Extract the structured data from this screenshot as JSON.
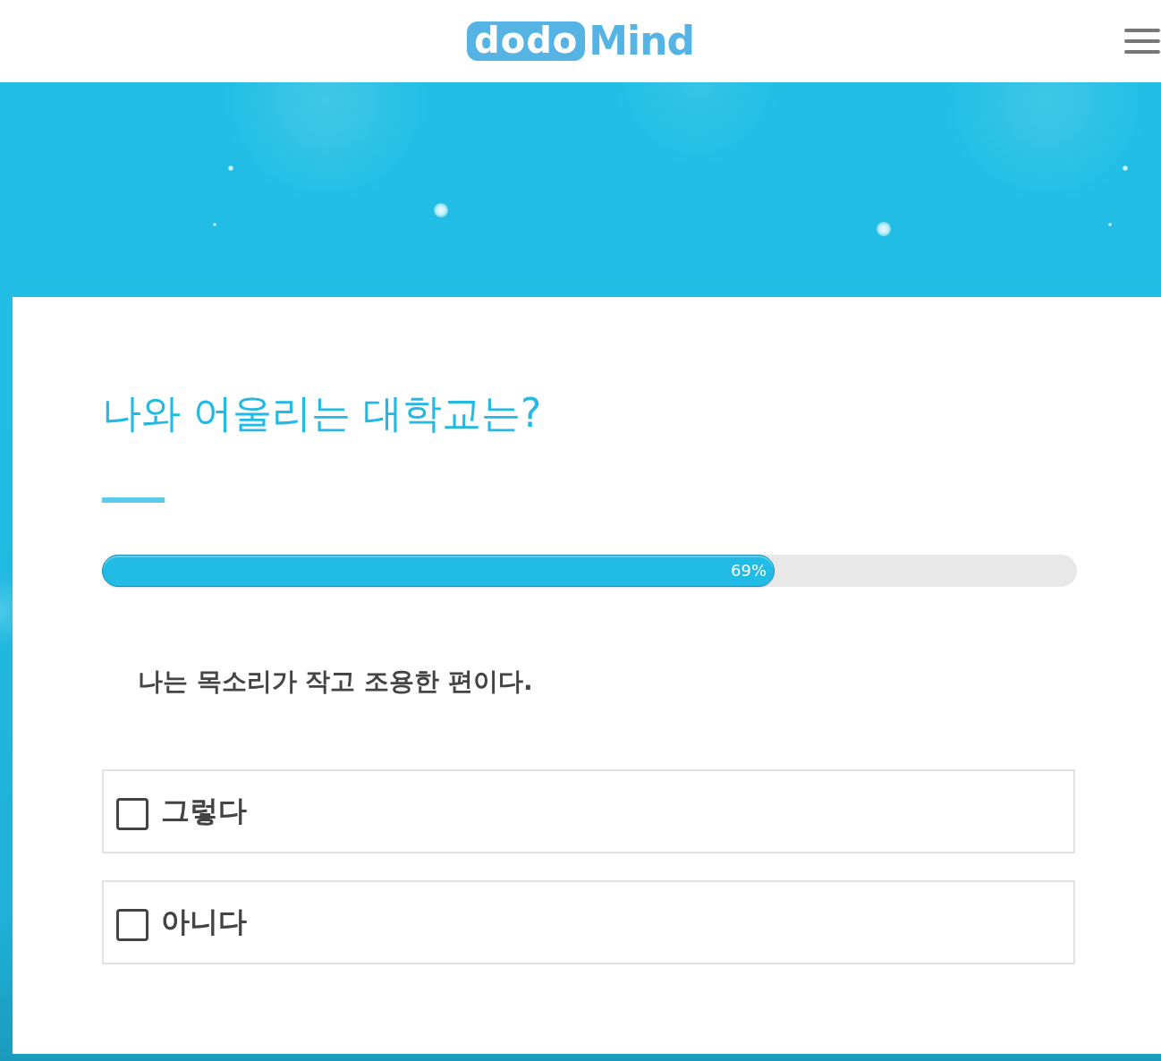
{
  "header": {
    "logo": {
      "boxed_text": "dodo",
      "text": "Mind"
    }
  },
  "quiz": {
    "title": "나와 어울리는 대학교는?",
    "progress": {
      "level": 0.69,
      "reading": "69%"
    },
    "question": "나는 목소리가 작고 조용한 편이다.",
    "options": [
      {
        "label": "그렇다",
        "checked": false
      },
      {
        "label": "아니다",
        "checked": false
      }
    ]
  }
}
